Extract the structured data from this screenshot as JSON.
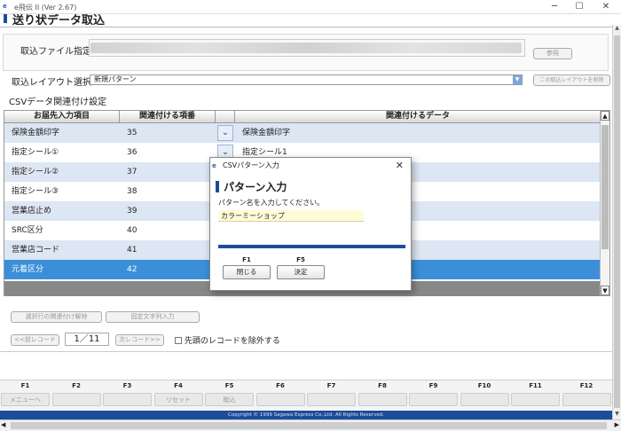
{
  "app": {
    "title": "e飛伝 II (Ver 2.67)",
    "logo": "e"
  },
  "page": {
    "title": "送り状データ取込"
  },
  "file": {
    "label": "取込ファイル指定",
    "path": "",
    "browse_label": "参照"
  },
  "layout": {
    "label": "取込レイアウト選択",
    "value": "新規パターン",
    "delete_label": "この取込レイアウトを削除"
  },
  "csv": {
    "section_label": "CSVデータ関連付け設定"
  },
  "grid": {
    "headers": [
      "お届先入力項目",
      "関連付ける項番",
      "関連付けるデータ"
    ],
    "rows": [
      {
        "item": "保険金額印字",
        "num": "35",
        "data": "保険金額印字",
        "dropdown": true
      },
      {
        "item": "指定シール①",
        "num": "36",
        "data": "指定シール1",
        "dropdown": true
      },
      {
        "item": "指定シール②",
        "num": "37",
        "data": ""
      },
      {
        "item": "指定シール③",
        "num": "38",
        "data": ""
      },
      {
        "item": "営業店止め",
        "num": "39",
        "data": ""
      },
      {
        "item": "SRC区分",
        "num": "40",
        "data": ""
      },
      {
        "item": "営業店コード",
        "num": "41",
        "data": ""
      },
      {
        "item": "元着区分",
        "num": "42",
        "data": ""
      }
    ]
  },
  "actions": {
    "clear_label": "選択行の関連付け解除",
    "fixed_label": "固定文字列入力"
  },
  "pager": {
    "prev_label": "<<前レコード",
    "page": "1／11",
    "next_label": "次レコード>>",
    "exclude_label": "先頭のレコードを除外する"
  },
  "fkeys": [
    {
      "key": "F1",
      "label": "メニューへ"
    },
    {
      "key": "F2",
      "label": ""
    },
    {
      "key": "F3",
      "label": ""
    },
    {
      "key": "F4",
      "label": "リセット"
    },
    {
      "key": "F5",
      "label": "取込"
    },
    {
      "key": "F6",
      "label": ""
    },
    {
      "key": "F7",
      "label": ""
    },
    {
      "key": "F8",
      "label": ""
    },
    {
      "key": "F9",
      "label": ""
    },
    {
      "key": "F10",
      "label": ""
    },
    {
      "key": "F11",
      "label": ""
    },
    {
      "key": "F12",
      "label": ""
    }
  ],
  "copyright": "Copyright © 1999 Sagawa Express Co.,Ltd. All Rights Reserved.",
  "dialog": {
    "title": "CSVパターン入力",
    "heading": "パターン入力",
    "prompt": "パターン名を入力してください。",
    "value": "カラーミーショップ",
    "f1_key": "F1",
    "close_label": "閉じる",
    "f5_key": "F5",
    "ok_label": "決定"
  },
  "colors": {
    "accent": "#1d4d9a",
    "selected": "#3b8fd9",
    "alt_row": "#dde6f3"
  }
}
